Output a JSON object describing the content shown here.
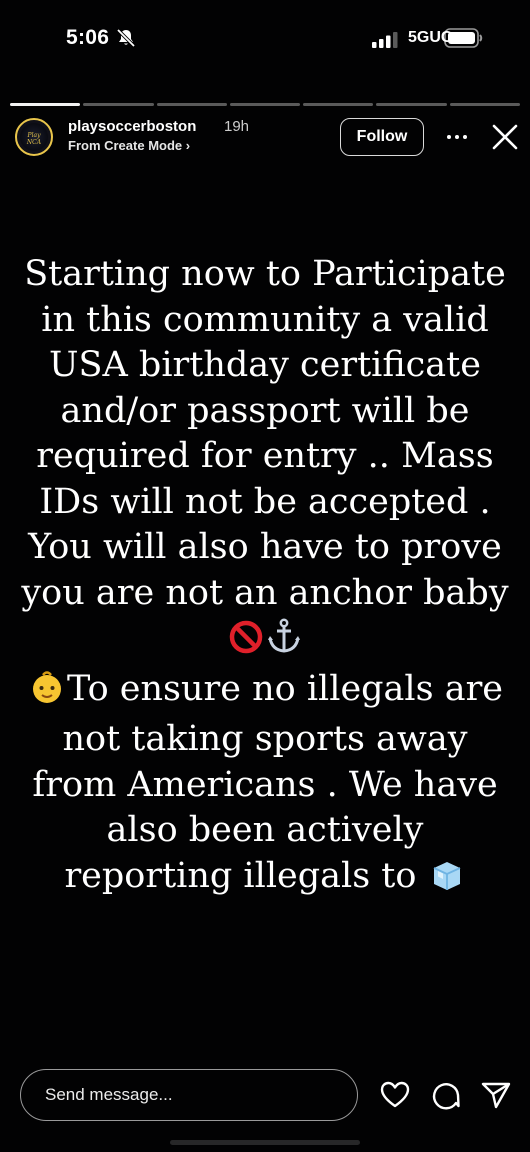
{
  "status_bar": {
    "time": "5:06",
    "network": "5GUC",
    "silent_icon": "bell-slash-icon",
    "signal_icon": "cellular-signal-icon",
    "battery_icon": "battery-icon"
  },
  "story": {
    "segment_count": 7,
    "completed_segments": 1,
    "account": {
      "avatar_text": "Play NCA",
      "username": "playsoccerboston",
      "time_ago": "19h",
      "subtitle": "From Create Mode ›"
    },
    "follow_label": "Follow",
    "more_icon": "more-dots-icon",
    "close_icon": "close-icon",
    "text_part1": "Starting now to Participate in this community a valid USA birthday certificate and/or passport will be required for entry .. Mass IDs will not be accepted . You will also have to prove you are not an anchor baby ",
    "text_part2": "To ensure no illegals are not taking sports away from Americans . We have also been actively reporting illegals to ",
    "emojis": [
      "prohibited-emoji",
      "anchor-emoji",
      "baby-emoji",
      "ice-cube-emoji"
    ]
  },
  "composer": {
    "placeholder": "Send message...",
    "heart_icon": "heart-icon",
    "comment_icon": "comment-icon",
    "share_icon": "send-icon"
  },
  "colors": {
    "background": "#020203",
    "text": "#ffffff",
    "avatar_ring": "#e9c54b"
  }
}
